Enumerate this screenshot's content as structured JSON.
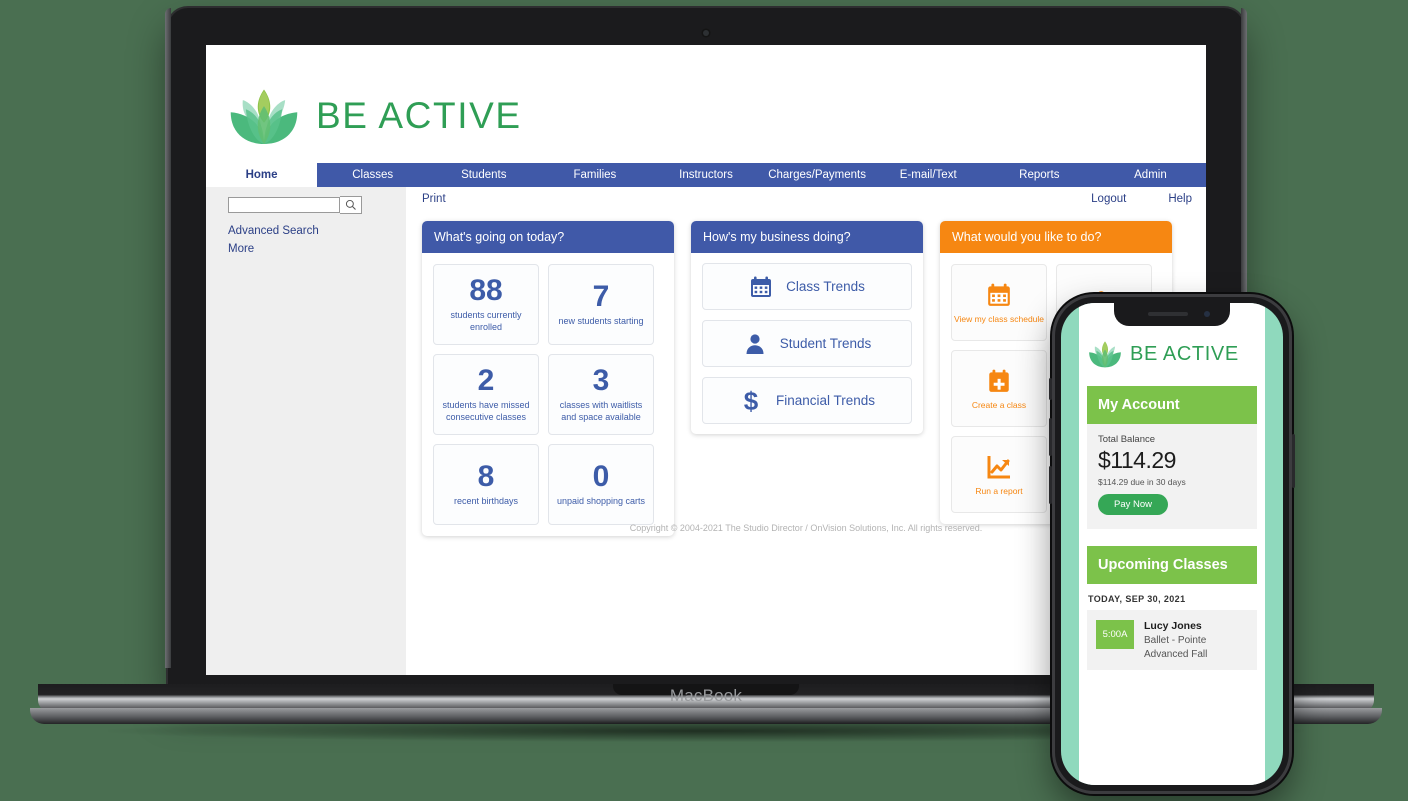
{
  "background_color": "#4a6f51",
  "device": {
    "laptop_label": "MacBook"
  },
  "brand": {
    "name": "BE ACTIVE",
    "color": "#2f9e55"
  },
  "nav": {
    "items": [
      {
        "label": "Home",
        "active": true
      },
      {
        "label": "Classes",
        "active": false
      },
      {
        "label": "Students",
        "active": false
      },
      {
        "label": "Families",
        "active": false
      },
      {
        "label": "Instructors",
        "active": false
      },
      {
        "label": "Charges/Payments",
        "active": false
      },
      {
        "label": "E-mail/Text",
        "active": false
      },
      {
        "label": "Reports",
        "active": false
      },
      {
        "label": "Admin",
        "active": false
      }
    ]
  },
  "sidebar": {
    "search_placeholder": "",
    "search_value": "",
    "links": [
      "Advanced Search",
      "More"
    ]
  },
  "toolbar": {
    "print": "Print",
    "logout": "Logout",
    "help": "Help"
  },
  "panels": {
    "today": {
      "title": "What's going on today?",
      "accent": "#4059a8",
      "stats": [
        {
          "value": "88",
          "label": "students currently enrolled"
        },
        {
          "value": "7",
          "label": "new students starting"
        },
        {
          "value": "2",
          "label": "students have missed consecutive classes"
        },
        {
          "value": "3",
          "label": "classes with waitlists and space available"
        },
        {
          "value": "8",
          "label": "recent birthdays"
        },
        {
          "value": "0",
          "label": "unpaid shopping carts"
        }
      ]
    },
    "business": {
      "title": "How's my business doing?",
      "accent": "#4059a8",
      "buttons": [
        {
          "label": "Class Trends",
          "icon": "calendar-icon"
        },
        {
          "label": "Student Trends",
          "icon": "person-icon"
        },
        {
          "label": "Financial Trends",
          "icon": "dollar-icon"
        }
      ]
    },
    "actions": {
      "title": "What would you like to do?",
      "accent": "#f68712",
      "buttons": [
        {
          "label": "View my class schedule",
          "icon": "calendar-icon"
        },
        {
          "label": "",
          "icon": "add-person-icon"
        },
        {
          "label": "Create a class",
          "icon": "calendar-plus-icon"
        },
        {
          "label": "",
          "icon": "hidden-icon"
        },
        {
          "label": "Run a report",
          "icon": "chart-line-icon"
        },
        {
          "label": "",
          "icon": "hidden-icon"
        }
      ]
    }
  },
  "footer": {
    "copyright": "Copyright © 2004-2021 The Studio Director / OnVision Solutions, Inc. All rights reserved."
  },
  "phone": {
    "brand": "BE ACTIVE",
    "account": {
      "title": "My Account",
      "balance_label": "Total Balance",
      "balance": "$114.29",
      "due_text": "$114.29 due in 30 days",
      "pay_button": "Pay Now"
    },
    "upcoming": {
      "title": "Upcoming Classes",
      "date": "TODAY, SEP 30, 2021",
      "classes": [
        {
          "time": "5:00A",
          "instructor": "Lucy Jones",
          "name": "Ballet - Pointe",
          "level": "Advanced Fall"
        }
      ]
    }
  }
}
